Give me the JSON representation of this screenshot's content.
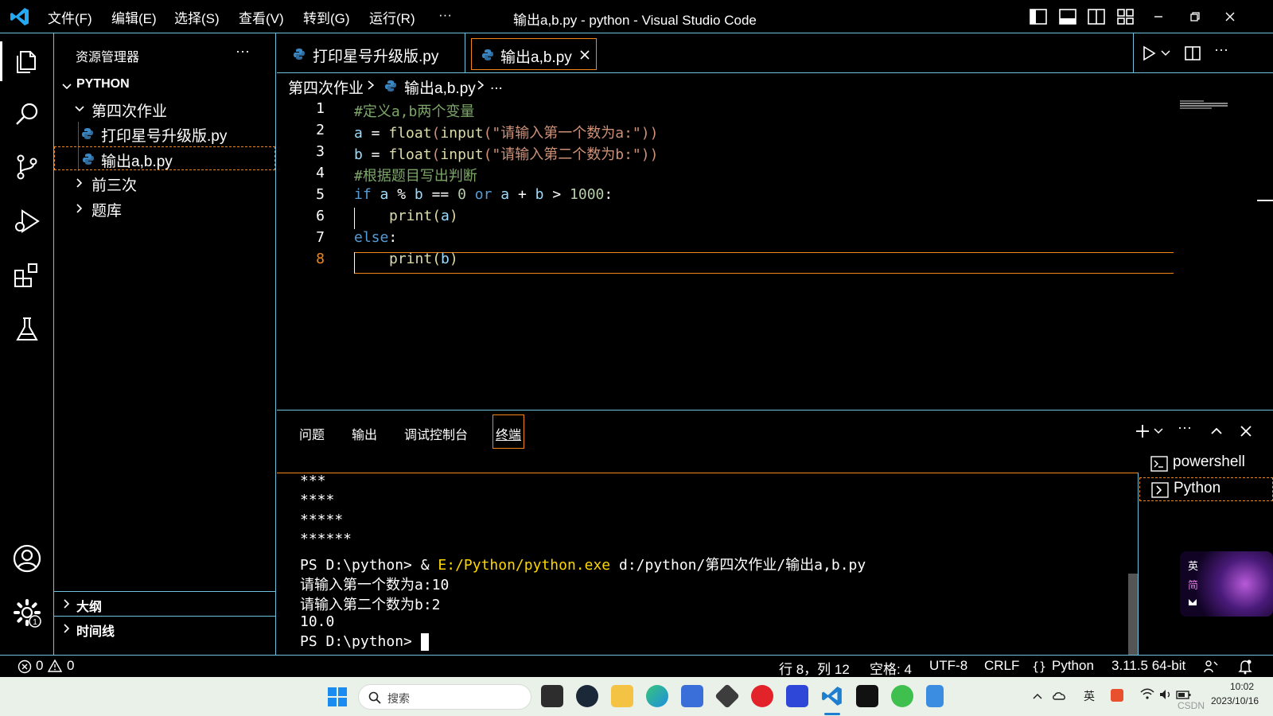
{
  "titlebar": {
    "menus": [
      "文件(F)",
      "编辑(E)",
      "选择(S)",
      "查看(V)",
      "转到(G)",
      "运行(R)",
      "···"
    ],
    "title": "输出a,b.py - python - Visual Studio Code"
  },
  "sidebar": {
    "header": "资源管理器",
    "more": "···",
    "root": "PYTHON",
    "items": [
      {
        "label": "第四次作业"
      },
      {
        "label": "打印星号升级版.py"
      },
      {
        "label": "输出a,b.py"
      },
      {
        "label": "前三次"
      },
      {
        "label": "题库"
      }
    ],
    "outline": "大纲",
    "timeline": "时间线"
  },
  "tabs": [
    {
      "label": "打印星号升级版.py"
    },
    {
      "label": "输出a,b.py"
    }
  ],
  "breadcrumb": {
    "folder": "第四次作业",
    "file": "输出a,b.py",
    "more": "..."
  },
  "editor": {
    "line_numbers": [
      "1",
      "2",
      "3",
      "4",
      "5",
      "6",
      "7",
      "8"
    ],
    "line1": "#定义a,b两个变量",
    "line2": {
      "a": "a",
      "eq": " = ",
      "float": "float",
      "p1": "(",
      "input": "input",
      "p2": "(",
      "str": "\"请输入第一个数为a:\"",
      "p3": "))"
    },
    "line3": {
      "a": "b",
      "eq": " = ",
      "float": "float",
      "p1": "(",
      "input": "input",
      "p2": "(",
      "str": "\"请输入第二个数为b:\"",
      "p3": "))"
    },
    "line4": "#根据题目写出判断",
    "line5": {
      "if": "if",
      "a": " a",
      "op1": " % ",
      "b": "b",
      "op2": " == ",
      "zero": "0",
      "or": " or",
      "a2": " a",
      "op3": " + ",
      "b2": "b",
      "op4": " > ",
      "k": "1000",
      "colon": ":"
    },
    "line6": {
      "print": "print",
      "p1": "(",
      "a": "a",
      "p2": ")"
    },
    "line7": {
      "else": "else",
      "colon": ":"
    },
    "line8": {
      "print": "print",
      "p1": "(",
      "b": "b",
      "p2": ")"
    }
  },
  "panel": {
    "tabs": [
      "问题",
      "输出",
      "调试控制台",
      "终端"
    ],
    "terminal_lines": [
      "***",
      "****",
      "*****",
      "******"
    ],
    "cmd_prompt": "PS D:\\python> & ",
    "cmd_exe": "E:/Python/python.exe",
    "cmd_arg": " d:/python/第四次作业/输出a,b.py",
    "out1": "请输入第一个数为a:10",
    "out2": "请输入第二个数为b:2",
    "out3": "10.0",
    "prompt": "PS D:\\python> ",
    "terminals": [
      "powershell",
      "Python"
    ]
  },
  "ime": {
    "lang": "英",
    "mode": "简"
  },
  "status": {
    "errors": "0",
    "warnings": "0",
    "position": "行 8，列 12",
    "spaces": "空格: 4",
    "encoding": "UTF-8",
    "eol": "CRLF",
    "language": "Python",
    "interpreter": "3.11.5 64-bit"
  },
  "taskbar": {
    "search": "搜索",
    "time": "10:02",
    "date": "2023/10/16",
    "tray_lang": "英",
    "watermark": "CSDN"
  },
  "colors": {
    "accent": "#6fc3df",
    "focus": "#f38518",
    "vscode_blue": "#23a9f2"
  }
}
